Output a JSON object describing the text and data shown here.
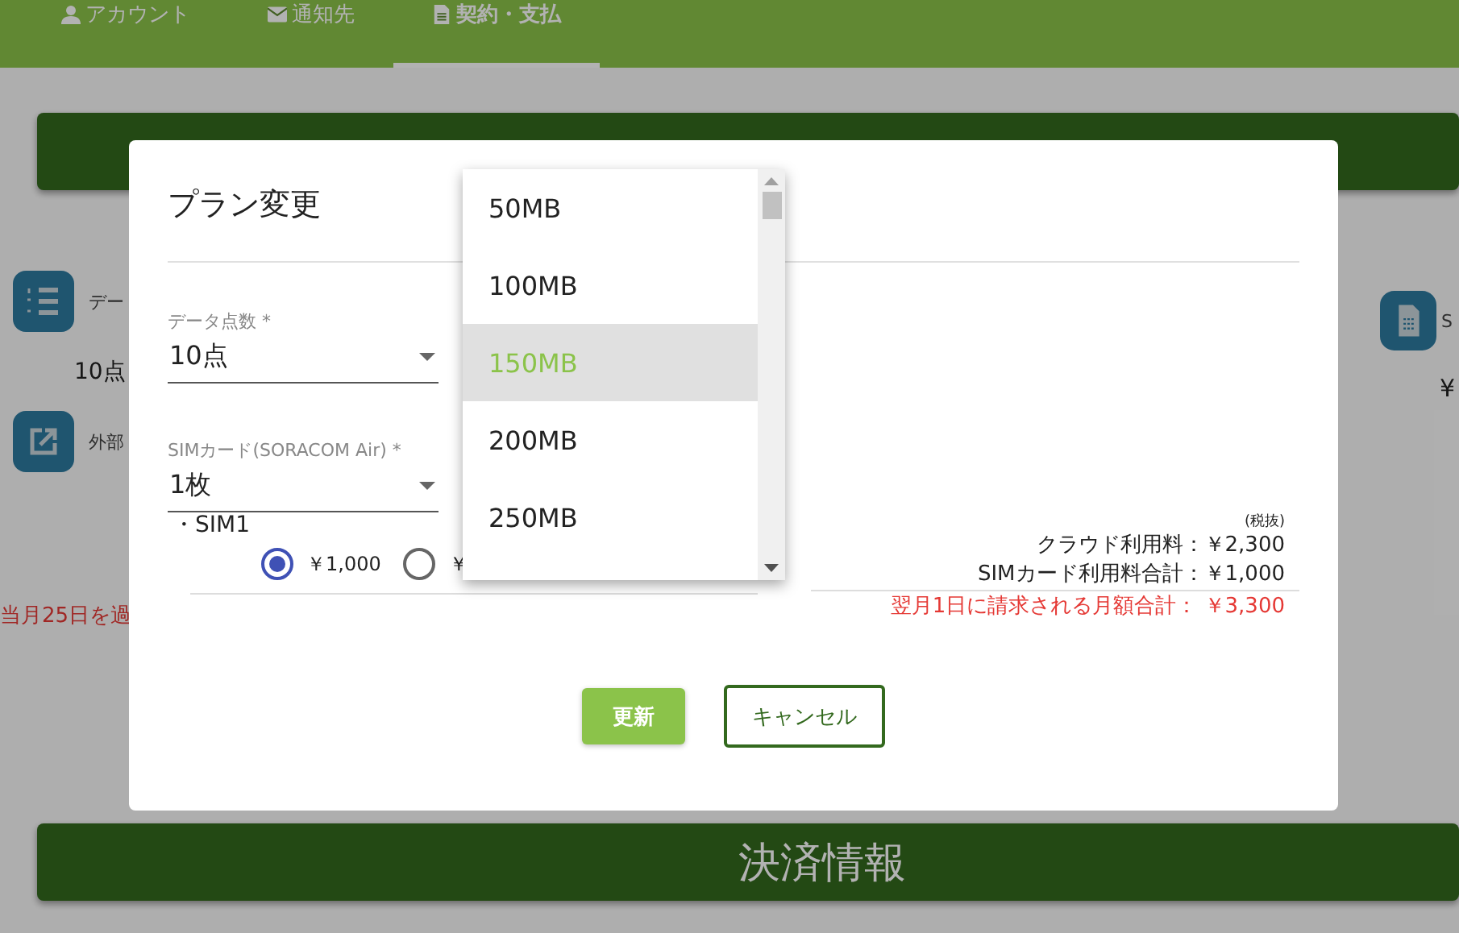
{
  "nav": {
    "tabs": [
      {
        "label": "アカウント",
        "selected": false
      },
      {
        "label": "通知先",
        "selected": false
      },
      {
        "label": "契約・支払",
        "selected": true
      }
    ]
  },
  "page": {
    "left_items": [
      {
        "label": "デー",
        "value": "10点"
      },
      {
        "label": "外部"
      }
    ],
    "notice": "当月25日を過",
    "right_item": {
      "label": "S",
      "value": "¥"
    },
    "section_title": "決済情報"
  },
  "dialog": {
    "title": "プラン変更",
    "fields": [
      {
        "label": "データ点数 *",
        "value": "10点"
      },
      {
        "label": "SIMカード(SORACOM Air) *",
        "value": "1枚"
      }
    ],
    "sim_label": "・SIM1",
    "sim_options": [
      {
        "label": "￥1,000",
        "selected": true
      },
      {
        "label": "￥",
        "selected": false
      }
    ],
    "summary": {
      "note": "(税抜)",
      "lines": [
        "クラウド利用料：￥2,300",
        "SIMカード利用料合計：￥1,000"
      ],
      "total": "翌月1日に請求される月額合計： ￥3,300"
    },
    "buttons": [
      {
        "label": "更新",
        "kind": "primary"
      },
      {
        "label": "キャンセル",
        "kind": "outline"
      }
    ],
    "dropdown": {
      "options": [
        {
          "label": "50MB",
          "selected": false
        },
        {
          "label": "100MB",
          "selected": false
        },
        {
          "label": "150MB",
          "selected": true
        },
        {
          "label": "200MB",
          "selected": false
        },
        {
          "label": "250MB",
          "selected": false
        }
      ]
    }
  }
}
